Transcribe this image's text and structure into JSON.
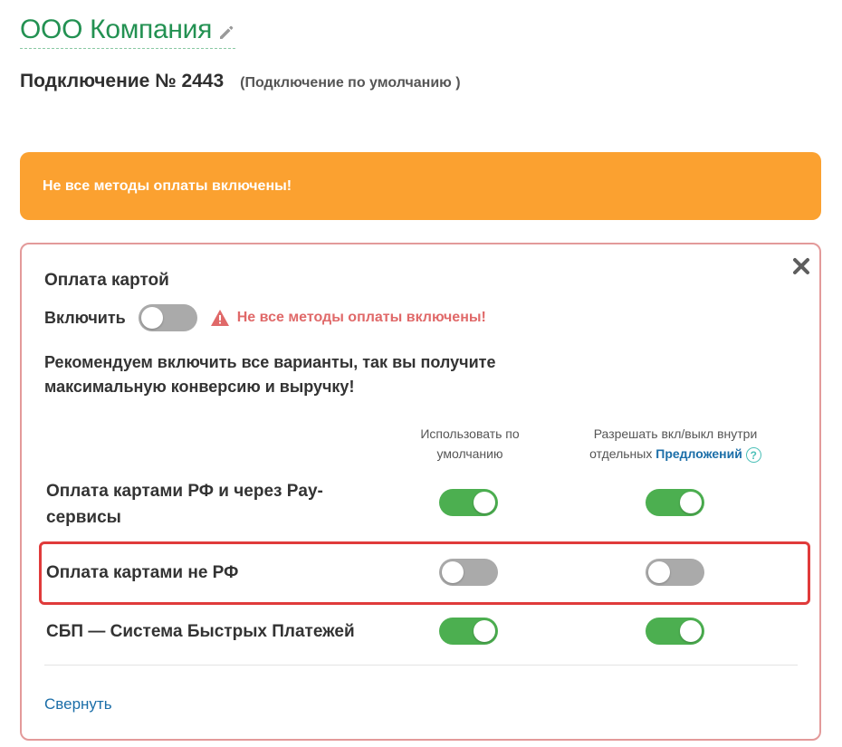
{
  "header": {
    "company_name": "ООО Компания",
    "connection_title": "Подключение № 2443",
    "connection_subtitle": "(Подключение по умолчанию )"
  },
  "banner": {
    "text": "Не все методы оплаты включены!",
    "color": "#fba130"
  },
  "card_payment": {
    "title": "Оплата картой",
    "enable_label": "Включить",
    "enabled": false,
    "warning": "Не все методы оплаты включены!",
    "recommendation": "Рекомендуем включить все варианты, так вы получите максимальную конверсию и выручку!",
    "columns": {
      "default_label": "Использовать по умолчанию",
      "allow_prefix": "Разрешать вкл/выкл внутри отдельных",
      "allow_link": "Предложений",
      "help_symbol": "?"
    },
    "methods": [
      {
        "label": "Оплата картами РФ и через Pay-сервисы",
        "use_default": true,
        "allow_toggle": true
      },
      {
        "label": "Оплата картами не РФ",
        "use_default": false,
        "allow_toggle": false,
        "highlighted": true
      },
      {
        "label": "СБП — Система Быстрых Платежей",
        "use_default": true,
        "allow_toggle": true
      }
    ],
    "collapse_label": "Свернуть"
  },
  "colors": {
    "accent_green": "#239152",
    "toggle_on": "#4caf50",
    "toggle_off": "#aaaaaa",
    "warning_red": "#e06969",
    "highlight_border": "#e03b3b",
    "link_blue": "#1b6ea8"
  },
  "icons": [
    "pencil-icon",
    "close-icon",
    "warning-triangle-icon",
    "help-icon"
  ]
}
